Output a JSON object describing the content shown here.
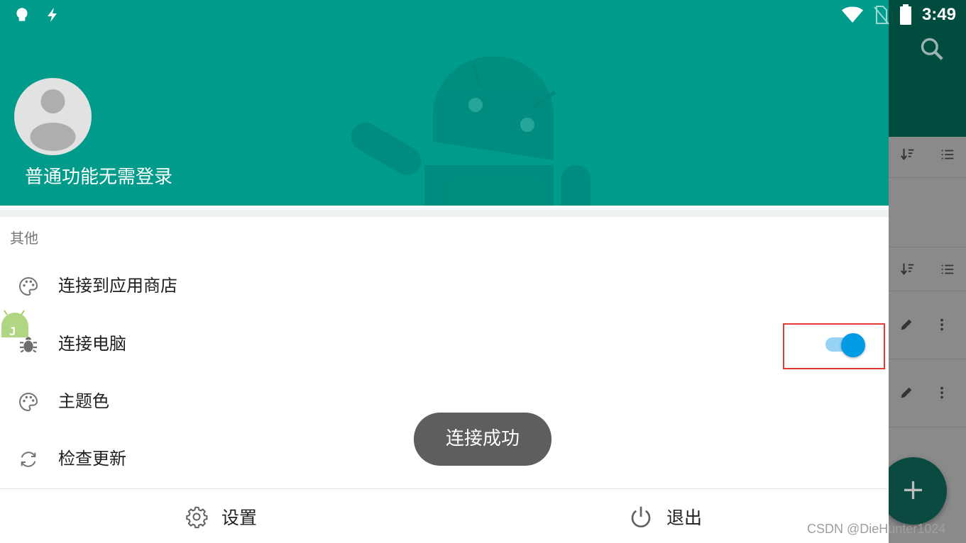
{
  "status_bar": {
    "time": "3:49",
    "left_icons": [
      "notification-app-icon",
      "flash-icon"
    ],
    "right_icons": [
      "wifi-icon",
      "no-sim-icon",
      "battery-icon"
    ]
  },
  "drawer": {
    "header": {
      "username": "普通功能无需登录",
      "background_color": "#009b8b"
    },
    "section_label": "其他",
    "items": [
      {
        "label": "连接到应用商店",
        "icon": "palette-icon"
      },
      {
        "label": "连接电脑",
        "icon": "bug-icon",
        "toggle_on": true
      },
      {
        "label": "主题色",
        "icon": "palette-icon"
      },
      {
        "label": "检查更新",
        "icon": "refresh-icon"
      }
    ],
    "bottom": {
      "settings_label": "设置",
      "logout_label": "退出"
    }
  },
  "toast": {
    "message": "连接成功"
  },
  "background_app": {
    "fab_label": "+",
    "toolbar_color": "#004d40"
  },
  "watermark": "CSDN @DieHunter1024",
  "colors": {
    "accent": "#039be5",
    "highlight": "#e53935"
  }
}
